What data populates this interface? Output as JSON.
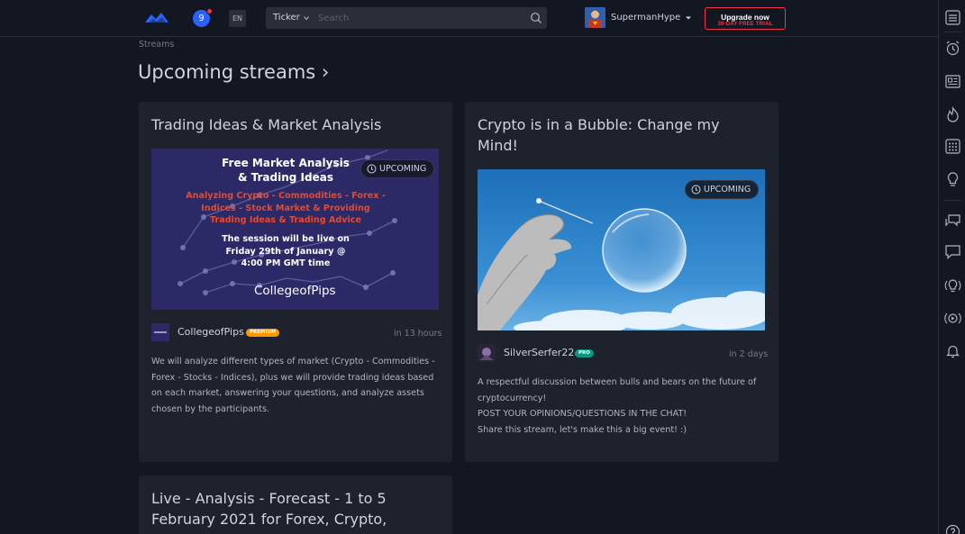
{
  "header": {
    "notification_count": "9",
    "language": "EN",
    "search": {
      "type_label": "Ticker",
      "placeholder": "Search"
    },
    "user": {
      "name": "SupermanHype"
    },
    "upgrade": {
      "label": "Upgrade now",
      "sublabel": "30-DAY FREE TRIAL"
    }
  },
  "breadcrumb": "Streams",
  "page_title": "Upcoming streams ›",
  "streams": [
    {
      "title": "Trading Ideas & Market Analysis",
      "status": "UPCOMING",
      "thumbnail": {
        "heading": [
          "Free Market Analysis",
          "& Trading Ideas"
        ],
        "subheading": [
          "Analyzing Crypto - Commodities - Forex -",
          "Indices - Stock Market & Providing",
          "Trading Ideas & Trading Advice"
        ],
        "session": [
          "The session will be live on",
          "Friday 29th of January @",
          "4:00 PM GMT time"
        ],
        "brand": "CollegeofPips"
      },
      "author": "CollegeofPips",
      "author_tag": "PREMIUM",
      "time": "in 13 hours",
      "description": [
        "We will analyze different types of market (Crypto - Commodities - Forex - Stocks - Indices), plus we will provide trading ideas based on each market, answering your questions, and analyze assets chosen by the participants."
      ]
    },
    {
      "title": "Crypto is in a Bubble: Change my Mind!",
      "status": "UPCOMING",
      "author": "SilverSerfer22",
      "author_tag": "PRO",
      "time": "in 2 days",
      "description": [
        "A respectful discussion between bulls and bears on the future of cryptocurrency!",
        "POST YOUR OPINIONS/QUESTIONS IN THE CHAT!",
        "Share this stream, let's make this a big event! :)"
      ]
    },
    {
      "title": "Live - Analysis - Forecast - 1 to 5 February 2021 for Forex, Crypto,"
    }
  ],
  "colors": {
    "background": "#131722",
    "card": "#1e222d",
    "accent_blue": "#2962ff",
    "upgrade_red": "#f23645",
    "premium_orange": "#ff9800",
    "pro_teal": "#089981"
  },
  "right_toolbar": [
    "watchlist-icon",
    "alert-clock-icon",
    "news-icon",
    "hotlist-icon",
    "calendar-icon",
    "ideas-bulb-icon",
    "chats-icon",
    "private-chat-icon",
    "idea-stream-icon",
    "streams-icon",
    "notifications-bell-icon",
    "help-icon"
  ]
}
